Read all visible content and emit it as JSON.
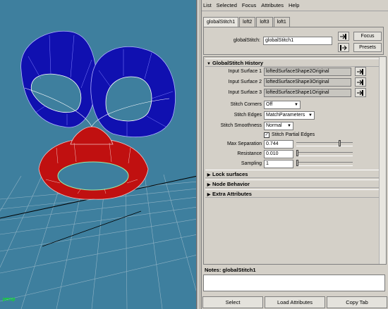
{
  "viewport": {
    "camera_label": "persp"
  },
  "menu": [
    "List",
    "Selected",
    "Focus",
    "Attributes",
    "Help"
  ],
  "tabs": [
    "globalStitch1",
    "loft2",
    "loft3",
    "loft1"
  ],
  "header": {
    "node_label": "globalStitch:",
    "node_value": "globalStitch1",
    "focus_label": "Focus",
    "presets_label": "Presets"
  },
  "sections": {
    "history": "GlobalStitch History",
    "lock": "Lock surfaces",
    "node": "Node Behavior",
    "extra": "Extra Attributes"
  },
  "inputs": [
    {
      "label": "Input Surface 1",
      "value": "loftedSurfaceShape2Original"
    },
    {
      "label": "Input Surface 2",
      "value": "loftedSurfaceShape3Original"
    },
    {
      "label": "Input Surface 3",
      "value": "loftedSurfaceShape1Original"
    }
  ],
  "stitch": {
    "corners_label": "Stitch Corners",
    "corners_value": "Off",
    "edges_label": "Stitch Edges",
    "edges_value": "MatchParameters",
    "smooth_label": "Stitch Smoothness",
    "smooth_value": "Normal",
    "partial_label": "Stitch Partial Edges",
    "partial_checked": true
  },
  "params": [
    {
      "label": "Max Separation",
      "value": "0.744",
      "level": 0.75
    },
    {
      "label": "Resistance",
      "value": "0.010",
      "level": 0.0
    },
    {
      "label": "Sampling",
      "value": "1",
      "level": 0.0
    }
  ],
  "notes": {
    "label": "Notes: globalStitch1"
  },
  "buttons": {
    "select": "Select",
    "load": "Load Attributes",
    "copy": "Copy Tab"
  },
  "colors": {
    "viewport_bg": "#3e7f9e",
    "surface_blue": "#1010b0",
    "surface_red": "#c01010",
    "panel_bg": "#d4d0c8"
  }
}
